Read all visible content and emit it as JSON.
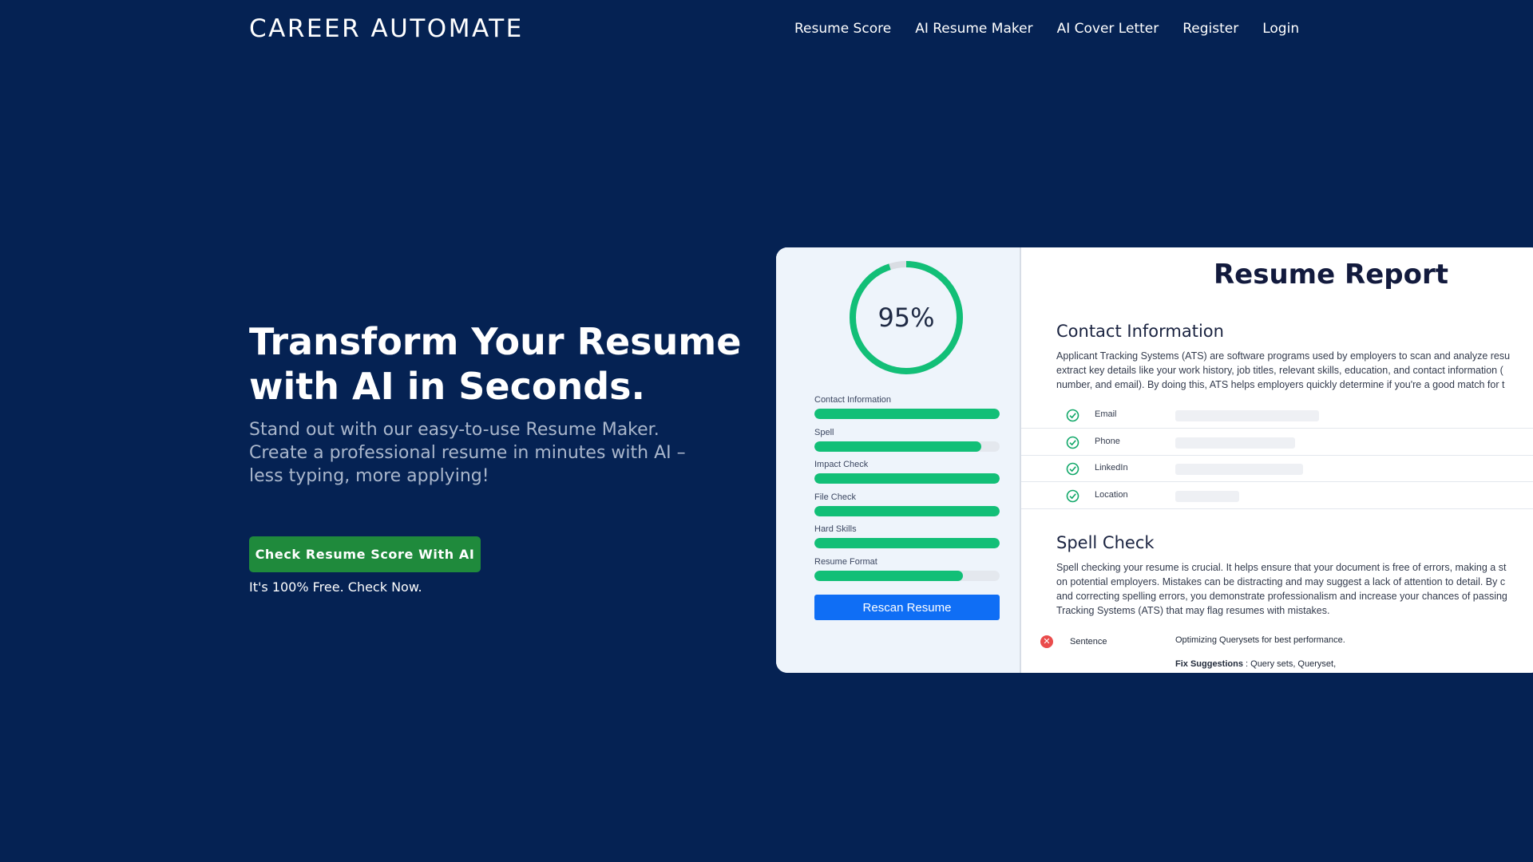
{
  "header": {
    "brand": "CAREER AUTOMATE",
    "nav": [
      "Resume Score",
      "AI Resume Maker",
      "AI Cover Letter",
      "Register",
      "Login"
    ]
  },
  "hero": {
    "title_line1": "Transform Your Resume",
    "title_line2": "with AI in Seconds.",
    "subtitle_line1": "Stand out with our easy-to-use Resume Maker.",
    "subtitle_line2": "Create a professional resume in minutes with AI –",
    "subtitle_line3": "less typing, more applying!",
    "cta_label": "Check Resume Score With AI",
    "cta_note": "It's 100% Free. Check Now."
  },
  "preview": {
    "score_text": "95%",
    "score_value": 0.95,
    "metrics": [
      {
        "label": "Contact Information",
        "value": 1.0
      },
      {
        "label": "Spell",
        "value": 0.9
      },
      {
        "label": "Impact Check",
        "value": 1.0
      },
      {
        "label": "File Check",
        "value": 1.0
      },
      {
        "label": "Hard Skills",
        "value": 1.0
      },
      {
        "label": "Resume Format",
        "value": 0.8
      }
    ],
    "rescan_label": "Rescan Resume",
    "report_title": "Resume Report",
    "contact": {
      "title": "Contact Information",
      "body": [
        "Applicant Tracking Systems (ATS) are software programs used by employers to scan and analyze resu",
        "extract key details like your work history, job titles, relevant skills, education, and contact information (",
        "number, and email). By doing this, ATS helps employers quickly determine if you're a good match for t"
      ],
      "rows": [
        "Email",
        "Phone",
        "LinkedIn",
        "Location"
      ]
    },
    "spell": {
      "title": "Spell Check",
      "body": [
        "Spell checking your resume is crucial. It helps ensure that your document is free of errors, making a st",
        "on potential employers. Mistakes can be distracting and may suggest a lack of attention to detail. By c",
        "and correcting spelling errors, you demonstrate professionalism and increase your chances of passing",
        "Tracking Systems (ATS) that may flag resumes with mistakes."
      ],
      "row_label": "Sentence",
      "row_value": "Optimizing Querysets for best performance.",
      "fix_label": "Fix Suggestions",
      "fix_value": " : Query sets, Queryset,"
    }
  },
  "colors": {
    "background": "#052253",
    "cta": "#1f8a3c",
    "progress": "#12bf77",
    "rescan": "#0f6ef5",
    "error": "#ea4c4c"
  }
}
